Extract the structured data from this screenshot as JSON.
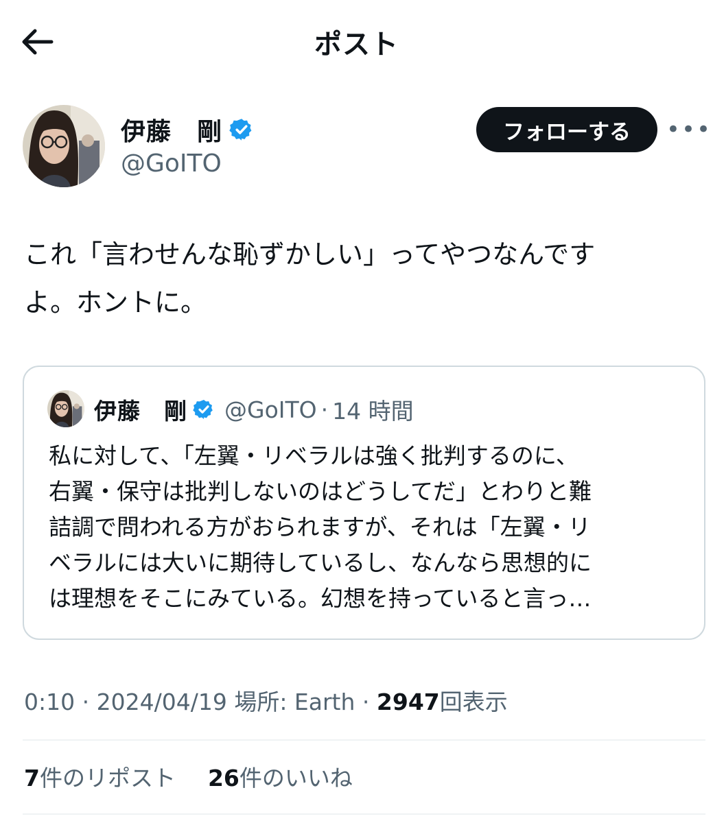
{
  "header": {
    "title": "ポスト",
    "back_icon": "arrow-left-icon"
  },
  "author": {
    "name": "伊藤　剛",
    "handle": "@GoITO",
    "verified_color": "#1d9bf0"
  },
  "follow_button": {
    "label": "フォローする"
  },
  "more_button": {
    "label": "•••"
  },
  "tweet": {
    "line1": "これ「言わせんな恥ずかしい」ってやつなんです",
    "line2": "よ。ホントに。"
  },
  "quote": {
    "name": "伊藤　剛",
    "handle": "@GoITO",
    "dot": "·",
    "time": "14 時間",
    "lines": [
      "私に対して、「左翼・リベラルは強く批判するのに、",
      "右翼・保守は批判しないのはどうしてだ」とわりと難",
      "詰調で問われる方がおられますが、それは「左翼・リ",
      "ベラルには大いに期待しているし、なんなら思想的に",
      "は理想をそこにみている。幻想を持っていると言っ…"
    ]
  },
  "meta": {
    "time": "0:10",
    "date": "2024/04/19",
    "location": "場所: Earth",
    "views_count": "2947",
    "views_label": "回表示",
    "dot": "·"
  },
  "stats": {
    "reposts_count": "7",
    "reposts_label": "件のリポスト",
    "likes_count": "26",
    "likes_label": "件のいいね"
  }
}
